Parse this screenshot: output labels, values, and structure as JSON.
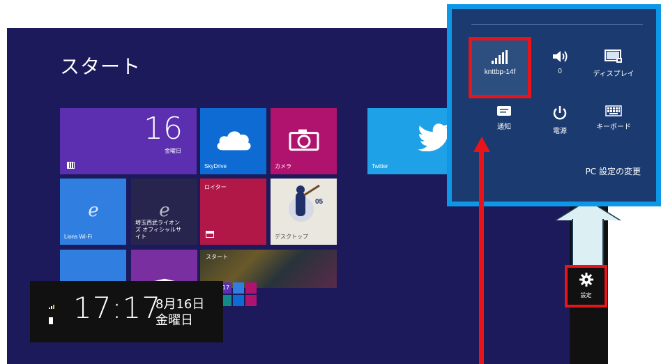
{
  "start": {
    "title": "スタート",
    "tiles": {
      "calendar": {
        "day": "16",
        "weekday": "金曜日"
      },
      "skydrive": "SkyDrive",
      "camera": "カメラ",
      "twitter": "Twitter",
      "lions": "Lions Wi-Fi",
      "saitama": "埼玉西武ライオンズ オフィシャルサイト",
      "reuters": "ロイター",
      "desktop": "デスクトップ",
      "startpic": "スタート",
      "mini_calendar": "17"
    }
  },
  "lock": {
    "time": "17:17",
    "date": "8月16日",
    "weekday": "金曜日"
  },
  "charm": {
    "settings_label": "設定"
  },
  "settings_panel": {
    "network": "knttbp-14f",
    "volume": "0",
    "display": "ディスプレイ",
    "notifications": "通知",
    "power": "電源",
    "keyboard": "キーボード",
    "pc_settings": "PC 設定の変更"
  },
  "colors": {
    "start_bg": "#1c1a5a",
    "panel_bg": "#1b3a6f",
    "panel_border": "#0d97e6",
    "highlight": "#e8141a"
  },
  "icons": [
    "signal-icon",
    "volume-icon",
    "display-icon",
    "notification-icon",
    "power-icon",
    "keyboard-icon",
    "gear-icon",
    "cloud-icon",
    "camera-icon",
    "twitter-bird-icon",
    "ie-icon",
    "store-icon"
  ]
}
